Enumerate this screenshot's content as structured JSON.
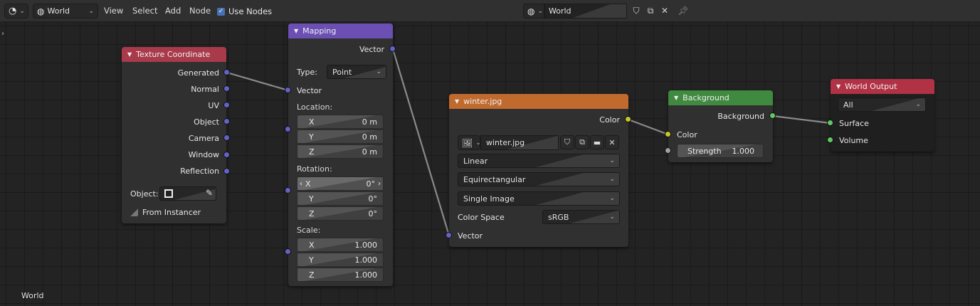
{
  "header": {
    "editor_type_icon": "node-editor-icon",
    "shader_type_label": "World",
    "menus": [
      "View",
      "Select",
      "Add",
      "Node"
    ],
    "use_nodes_label": "Use Nodes",
    "use_nodes_checked": true,
    "world_selector_label": "World"
  },
  "footer": {
    "context_label": "World"
  },
  "colors": {
    "input_header": "#a83a4a",
    "vector_header": "#6b4fb3",
    "texture_header": "#c06a2e",
    "shader_header": "#3f8a3f",
    "output_header": "#b23245",
    "vector_socket": "#6363c7",
    "color_socket": "#c7c729",
    "shader_socket": "#63c763"
  },
  "nodes": {
    "texcoord": {
      "title": "Texture Coordinate",
      "outputs": [
        "Generated",
        "Normal",
        "UV",
        "Object",
        "Camera",
        "Window",
        "Reflection"
      ],
      "object_label": "Object:",
      "from_instancer_label": "From Instancer"
    },
    "mapping": {
      "title": "Mapping",
      "output_vector": "Vector",
      "type_label": "Type:",
      "type_value": "Point",
      "input_vector": "Vector",
      "location_label": "Location:",
      "location": [
        {
          "axis": "X",
          "value": "0 m"
        },
        {
          "axis": "Y",
          "value": "0 m"
        },
        {
          "axis": "Z",
          "value": "0 m"
        }
      ],
      "rotation_label": "Rotation:",
      "rotation": [
        {
          "axis": "X",
          "value": "0°"
        },
        {
          "axis": "Y",
          "value": "0°"
        },
        {
          "axis": "Z",
          "value": "0°"
        }
      ],
      "scale_label": "Scale:",
      "scale": [
        {
          "axis": "X",
          "value": "1.000"
        },
        {
          "axis": "Y",
          "value": "1.000"
        },
        {
          "axis": "Z",
          "value": "1.000"
        }
      ]
    },
    "image": {
      "title": "winter.jpg",
      "output_color": "Color",
      "image_name": "winter.jpg",
      "interpolation": "Linear",
      "projection": "Equirectangular",
      "source": "Single Image",
      "color_space_label": "Color Space",
      "color_space_value": "sRGB",
      "input_vector": "Vector"
    },
    "background": {
      "title": "Background",
      "output": "Background",
      "input_color": "Color",
      "strength_label": "Strength",
      "strength_value": "1.000"
    },
    "output": {
      "title": "World Output",
      "target": "All",
      "input_surface": "Surface",
      "input_volume": "Volume"
    }
  }
}
